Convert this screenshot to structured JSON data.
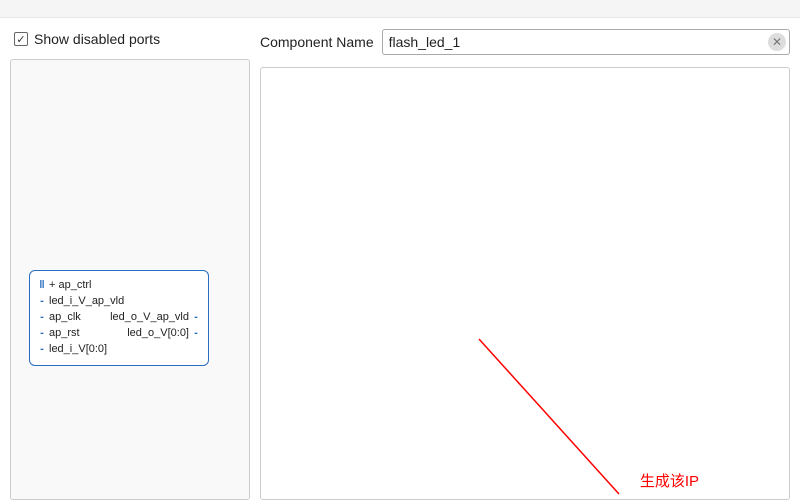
{
  "left_panel": {
    "checkbox_label": "Show disabled ports",
    "checkbox_checked": true,
    "ip_block": {
      "input_ports": [
        {
          "name": "+ ap_ctrl",
          "expandable": true
        },
        {
          "name": "led_i_V_ap_vld"
        },
        {
          "name": "ap_clk"
        },
        {
          "name": "ap_rst"
        },
        {
          "name": "led_i_V[0:0]"
        }
      ],
      "output_ports": [
        {
          "name": "led_o_V_ap_vld"
        },
        {
          "name": "led_o_V[0:0]"
        }
      ]
    }
  },
  "right_panel": {
    "component_name_label": "Component Name",
    "component_name_value": "flash_led_1",
    "annotation_text": "生成该IP"
  }
}
